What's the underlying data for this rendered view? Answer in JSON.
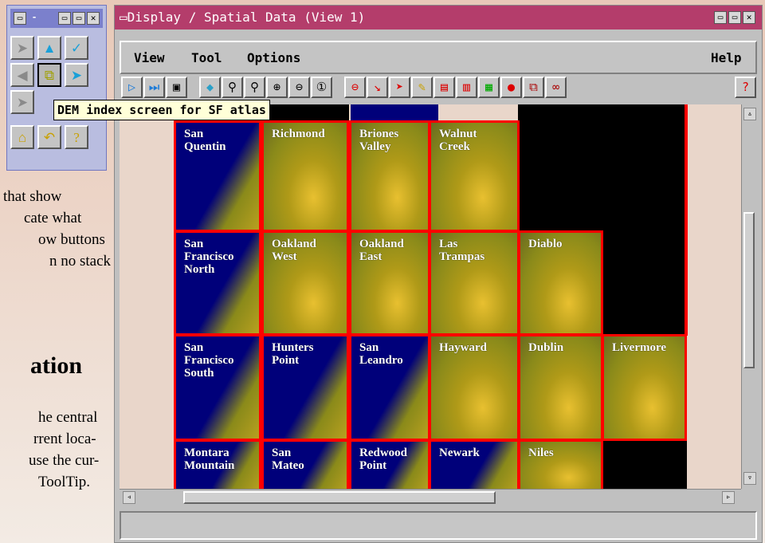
{
  "background_doc": {
    "line1": "that show",
    "line2": "cate what",
    "line3": "ow buttons",
    "line4": "n no stack",
    "heading": "ation",
    "line5": "he central",
    "line6": "rrent loca-",
    "line7": "use the cur-",
    "line8": "ToolTip."
  },
  "palette": {
    "title_controls": [
      "▭",
      "-",
      "▭",
      "▭",
      "✕"
    ],
    "buttons": [
      {
        "name": "select-arrow-icon",
        "glyph": "➤",
        "color": "#8a8a8a"
      },
      {
        "name": "caret-up-icon",
        "glyph": "▲",
        "color": "#1aa0d8"
      },
      {
        "name": "check-arrow-icon",
        "glyph": "✓",
        "color": "#1aa0d8"
      },
      {
        "name": "arrow-left-icon",
        "glyph": "◀",
        "color": "#8a8a8a"
      },
      {
        "name": "stack-icon",
        "glyph": "⧉",
        "color": "#a0a000"
      },
      {
        "name": "arrow-right-icon",
        "glyph": "➤",
        "color": "#1aa0d8"
      },
      {
        "name": "arrow-down-right-icon",
        "glyph": "➤",
        "color": "#8a8a8a"
      },
      {
        "name": "home-icon",
        "glyph": "⌂",
        "color": "#c8a000"
      },
      {
        "name": "undo-icon",
        "glyph": "↶",
        "color": "#c8a000"
      },
      {
        "name": "help-question-icon",
        "glyph": "?",
        "color": "#c8a000"
      }
    ]
  },
  "window": {
    "title": "▭Display / Spatial Data (View 1)",
    "menu": {
      "view": "View",
      "tool": "Tool",
      "options": "Options",
      "help": "Help"
    }
  },
  "tooltip": "DEM index screen for SF atlas",
  "map_tiles": [
    {
      "label": "San\nQuentin"
    },
    {
      "label": "Richmond"
    },
    {
      "label": "Briones\nValley"
    },
    {
      "label": "Walnut\nCreek"
    },
    {
      "label": "San\nFrancisco\nNorth"
    },
    {
      "label": "Oakland\nWest"
    },
    {
      "label": "Oakland\nEast"
    },
    {
      "label": "Las\nTrampas"
    },
    {
      "label": "Diablo"
    },
    {
      "label": "San\nFrancisco\nSouth"
    },
    {
      "label": "Hunters\nPoint"
    },
    {
      "label": "San\nLeandro"
    },
    {
      "label": "Hayward"
    },
    {
      "label": "Dublin"
    },
    {
      "label": "Livermore"
    },
    {
      "label": "Montara\nMountain"
    },
    {
      "label": "San\nMateo"
    },
    {
      "label": "Redwood\nPoint"
    },
    {
      "label": "Newark"
    },
    {
      "label": "Niles"
    }
  ],
  "colors": {
    "title_bar": "#b43d6b",
    "palette_title": "#7b80cc",
    "tile_border": "#ff0000",
    "water": "#00007a",
    "terrain": "#8a8a1a"
  }
}
